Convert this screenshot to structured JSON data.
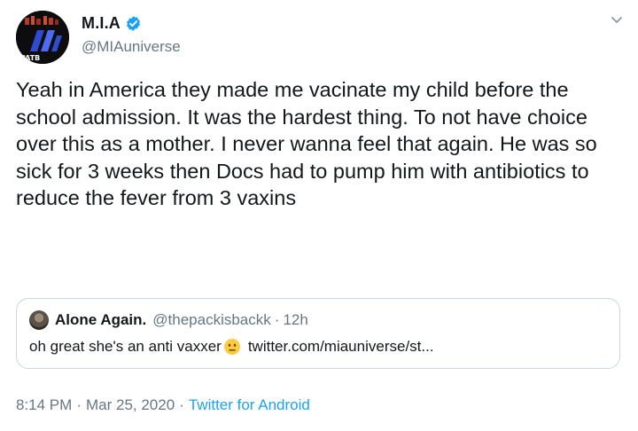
{
  "author": {
    "display_name": "M.I.A",
    "handle": "@MIAuniverse",
    "avatar_text": "PATB"
  },
  "tweet": {
    "text": "Yeah in America they made me vacinate my child before the school admission. It was the hardest thing. To not have choice over this as a mother. I never wanna feel that again. He was so sick for 3 weeks then Docs had to pump him with antibiotics to reduce the fever from 3 vaxins"
  },
  "quoted_tweet": {
    "display_name": "Alone Again.",
    "handle": "@thepackisbackk",
    "separator": "·",
    "time": "12h",
    "text_before_emoji": "oh great she's an anti vaxxer",
    "emoji": "neutral-face-emoji",
    "link": "twitter.com/miauniverse/st..."
  },
  "meta": {
    "time": "8:14 PM",
    "separator": "·",
    "date": "Mar 25, 2020",
    "source": "Twitter for Android"
  },
  "colors": {
    "text": "#14171a",
    "secondary": "#657786",
    "accent": "#1da1f2",
    "border": "#ccd6dd"
  }
}
